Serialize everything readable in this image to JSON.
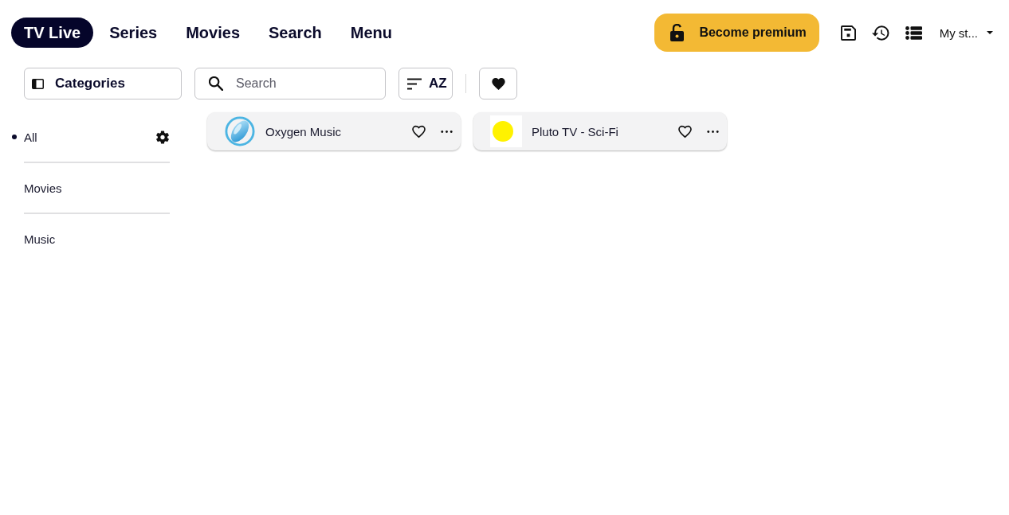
{
  "nav": {
    "tabs": [
      {
        "label": "TV Live",
        "selected": true
      },
      {
        "label": "Series",
        "selected": false
      },
      {
        "label": "Movies",
        "selected": false
      },
      {
        "label": "Search",
        "selected": false
      },
      {
        "label": "Menu",
        "selected": false
      }
    ],
    "premium_button": {
      "label": "Become premium"
    },
    "profile": {
      "label": "My st..."
    }
  },
  "toolbar": {
    "categories_button": {
      "label": "Categories"
    },
    "search": {
      "placeholder": "Search"
    },
    "sort_button": {
      "label": "AZ"
    }
  },
  "categories": [
    {
      "label": "All",
      "selected": true
    },
    {
      "label": "Movies",
      "selected": false
    },
    {
      "label": "Music",
      "selected": false
    }
  ],
  "channels": [
    {
      "name": "Oxygen Music",
      "kind": "swirl",
      "favorite": false
    },
    {
      "name": "Pluto TV - Sci-Fi",
      "kind": "disc",
      "favorite": false
    }
  ]
}
